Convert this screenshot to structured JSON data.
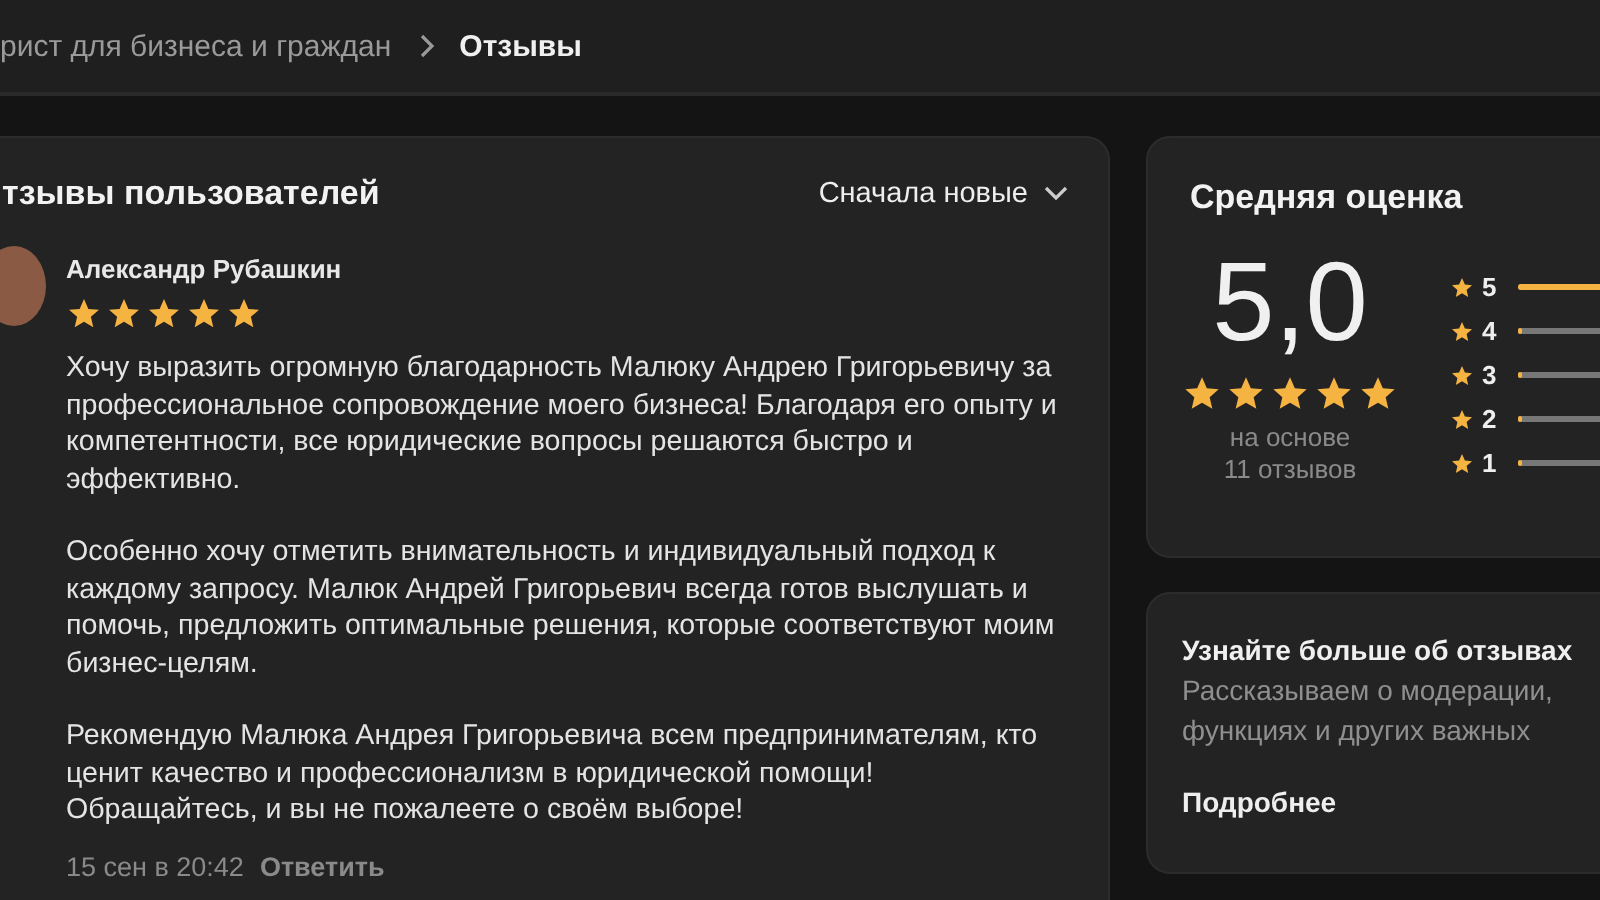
{
  "breadcrumb": {
    "items": [
      "рист для бизнеса и граждан",
      "Отзывы"
    ]
  },
  "reviews": {
    "title": "тзывы пользователей",
    "sort": "Сначала новые",
    "items": [
      {
        "author": "Александр Рубашкин",
        "stars": 5,
        "paragraphs": [
          "Хочу выразить огромную благодарность Малюку Андрею Григорьевичу за профессиональное сопровождение моего бизнеса! Благодаря его опыту и компетентности, все юридические вопросы решаются быстро и эффективно.",
          "Особенно хочу отметить внимательность и индивидуальный подход к каждому запросу. Малюк Андрей Григорьевич всегда готов выслушать и помочь, предложить оптимальные решения, которые соответствуют моим бизнес-целям.",
          "Рекомендую Малюка Андрея Григорьевича всем предпринимателям, кто ценит качество и профессионализм в юридической помощи! Обращайтесь, и вы не пожалеете о своём выборе!"
        ],
        "date": "15 сен в 20:42",
        "reply": "Ответить"
      }
    ]
  },
  "rating": {
    "title": "Средняя оценка",
    "score": "5,0",
    "stars": 5,
    "caption": [
      "на основе",
      "11 отзывов"
    ],
    "bars": [
      {
        "label": "5",
        "level": 1
      },
      {
        "label": "4",
        "level": 0
      },
      {
        "label": "3",
        "level": 0
      },
      {
        "label": "2",
        "level": 0
      },
      {
        "label": "1",
        "level": 0
      }
    ]
  },
  "info": {
    "title": "Узнайте больше об отзывах",
    "text": [
      "Рассказываем о модерации,",
      "функциях и других важных"
    ],
    "link": "Подробнее"
  }
}
